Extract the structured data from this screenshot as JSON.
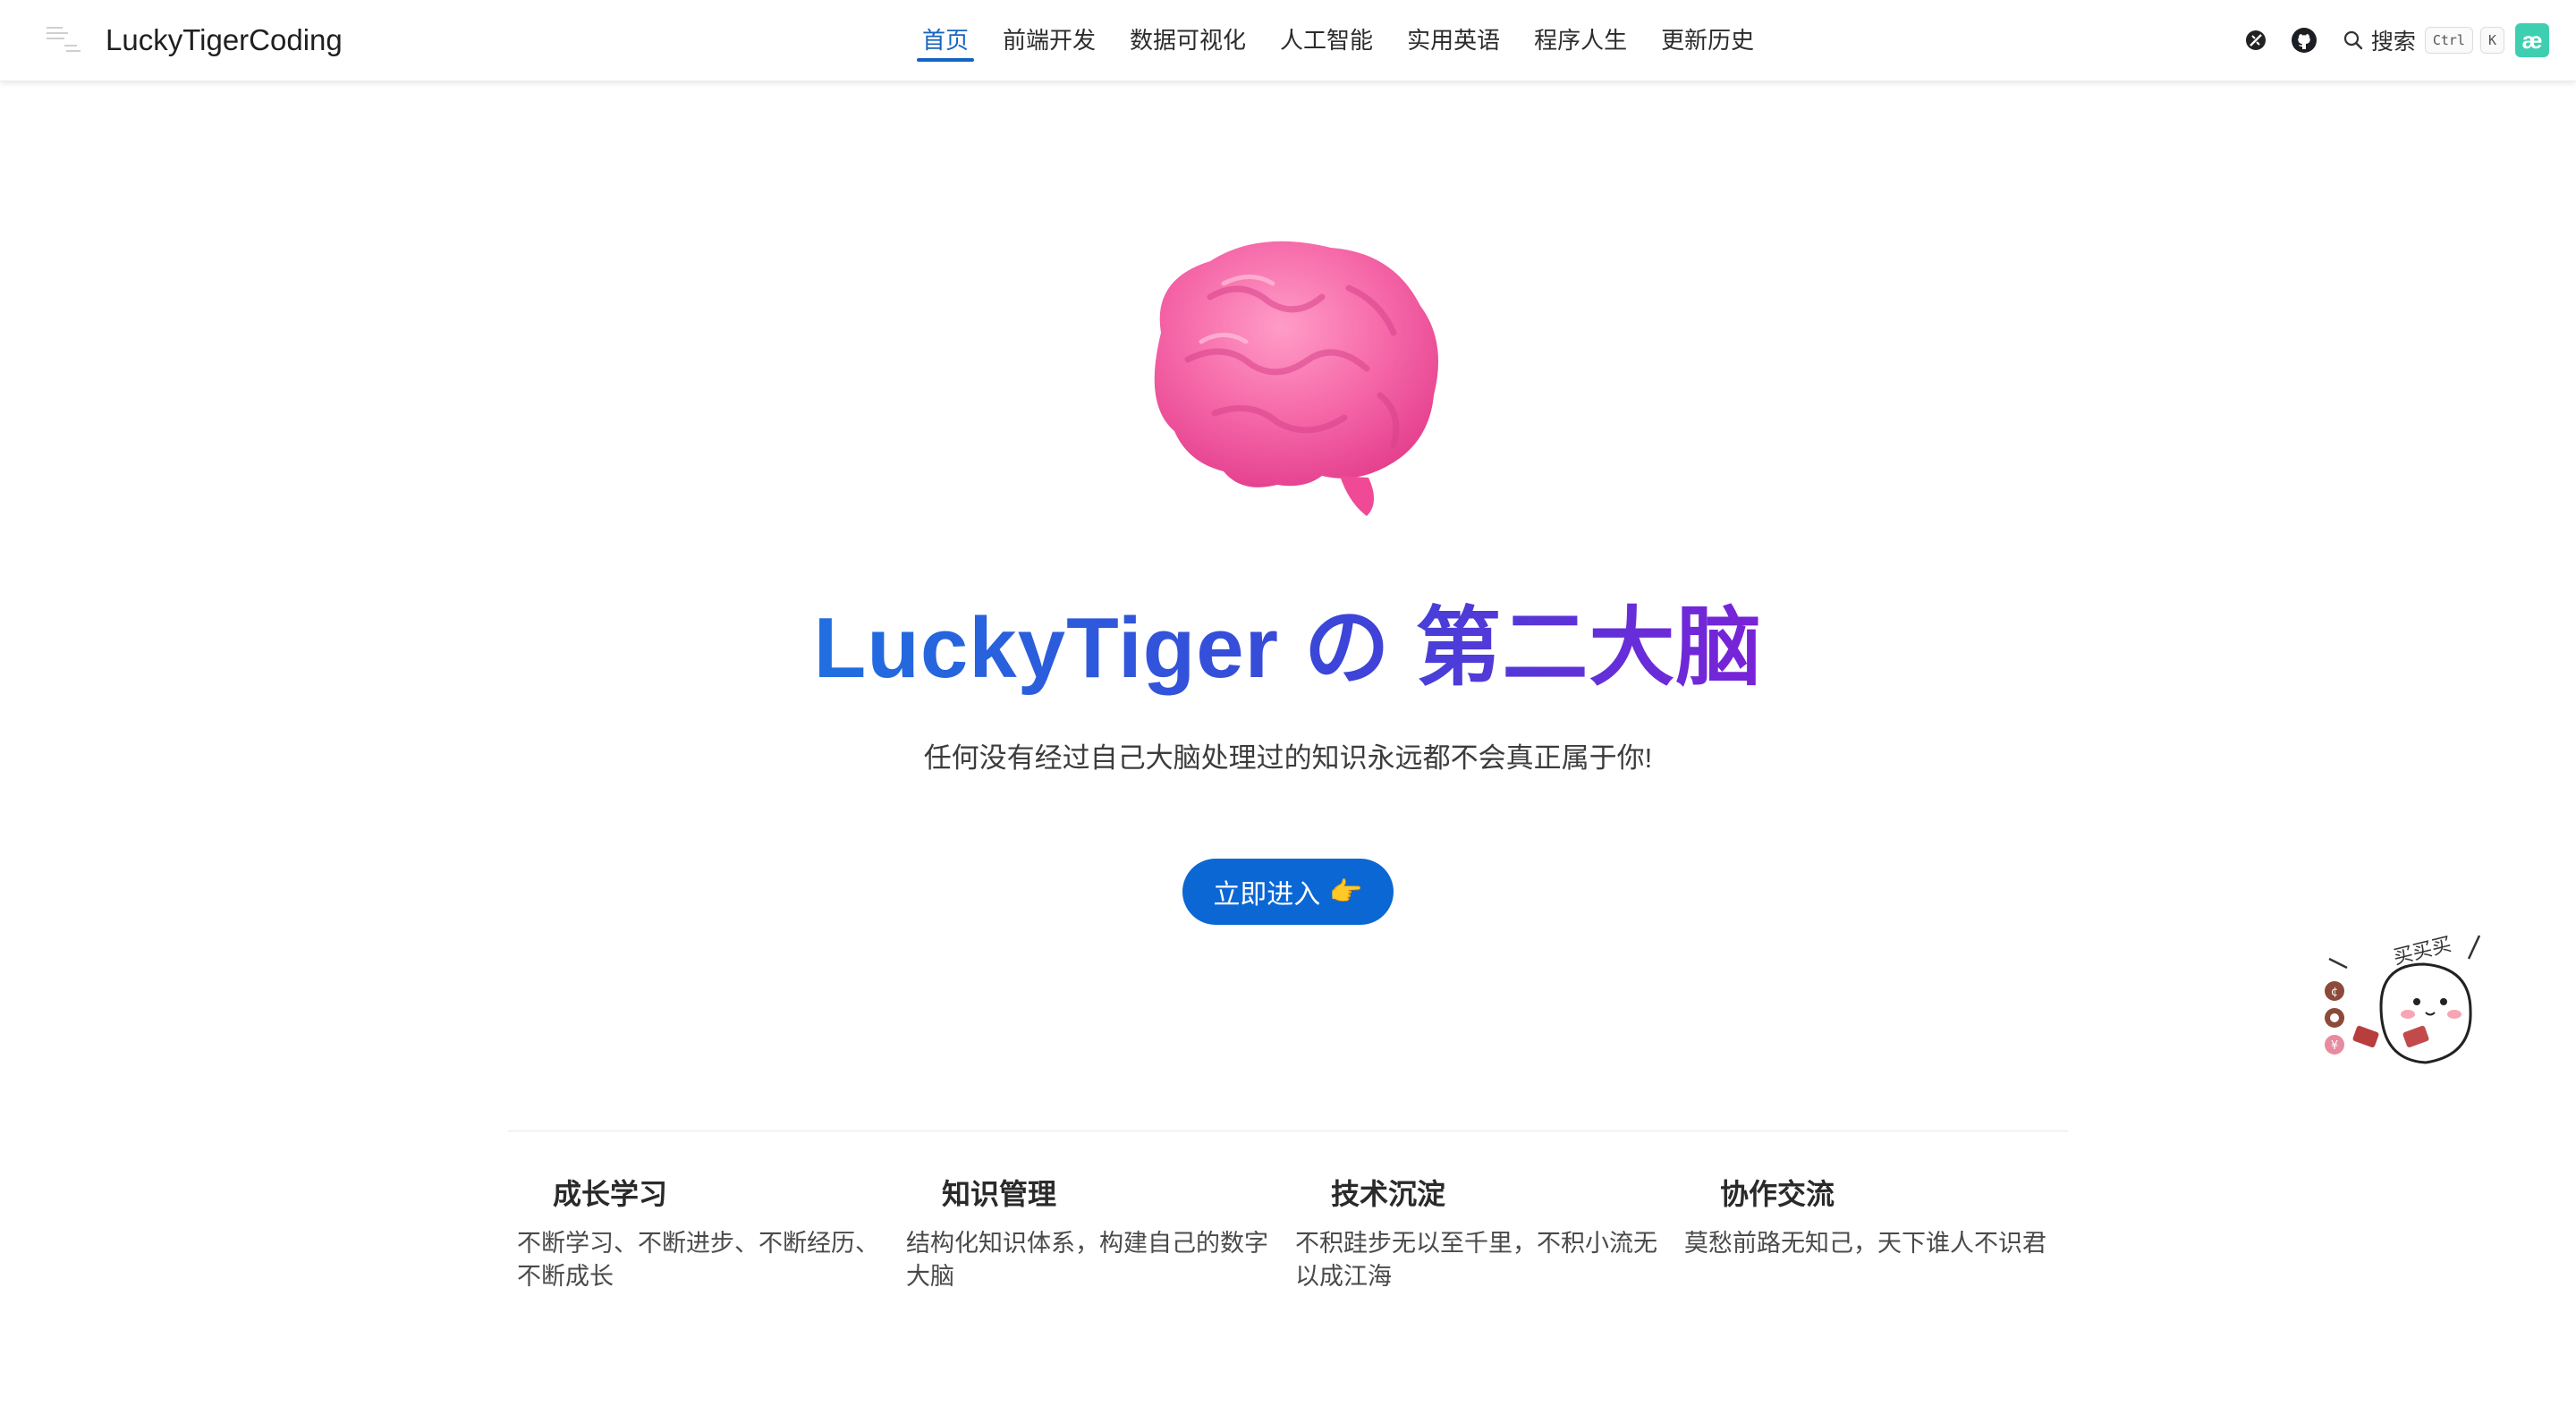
{
  "nav": {
    "site_name": "LuckyTigerCoding",
    "items": [
      {
        "label": "首页",
        "active": true
      },
      {
        "label": "前端开发"
      },
      {
        "label": "数据可视化"
      },
      {
        "label": "人工智能"
      },
      {
        "label": "实用英语"
      },
      {
        "label": "程序人生"
      },
      {
        "label": "更新历史"
      }
    ],
    "search_label": "搜索",
    "shortcut_keys": [
      "Ctrl",
      "K"
    ],
    "icons": [
      "theme-toggle-icon",
      "github-icon",
      "search-icon",
      "ae-logo-icon"
    ],
    "ae_text": "æ"
  },
  "hero": {
    "title": "LuckyTiger の 第二大脑",
    "tagline": "任何没有经过自己大脑处理过的知识永远都不会真正属于你!",
    "cta_label": "立即进入",
    "cta_icon": "👉"
  },
  "mascot": {
    "text": "买买买"
  },
  "features": [
    {
      "title": "成长学习",
      "desc": "不断学习、不断进步、不断经历、不断成长"
    },
    {
      "title": "知识管理",
      "desc": "结构化知识体系，构建自己的数字大脑"
    },
    {
      "title": "技术沉淀",
      "desc": "不积跬步无以至千里，不积小流无以成江海"
    },
    {
      "title": "协作交流",
      "desc": "莫愁前路无知己，天下谁人不识君"
    }
  ],
  "colors": {
    "accent": "#1565c0",
    "cta_bg": "#0b67d4",
    "title_gradient_start": "#1f6fe0",
    "title_gradient_end": "#7a22d8",
    "brain_pink": "#f05a9e"
  }
}
